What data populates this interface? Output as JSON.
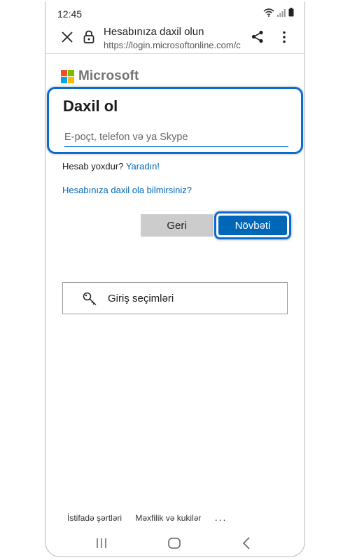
{
  "status": {
    "time": "12:45"
  },
  "browser": {
    "title": "Hesabınıza daxil olun",
    "url": "https://login.microsoftonline.com/c"
  },
  "brand": {
    "name": "Microsoft",
    "colors": [
      "#f25022",
      "#7fba00",
      "#00a4ef",
      "#ffb900"
    ]
  },
  "signin": {
    "heading": "Daxil ol",
    "email_placeholder": "E-poçt, telefon və ya Skype",
    "email_value": "",
    "no_account_text": "Hesab yoxdur?",
    "create_link": "Yaradın!",
    "cant_access_link": "Hesabınıza daxil ola bilmirsiniz?",
    "back_button": "Geri",
    "next_button": "Növbəti",
    "signin_options": "Giriş seçimləri"
  },
  "footer": {
    "terms": "İstifadə şərtləri",
    "privacy": "Məxfilik və kukilər",
    "more": "..."
  },
  "colors": {
    "accent": "#0067b8",
    "highlight": "#0a6bd1"
  }
}
